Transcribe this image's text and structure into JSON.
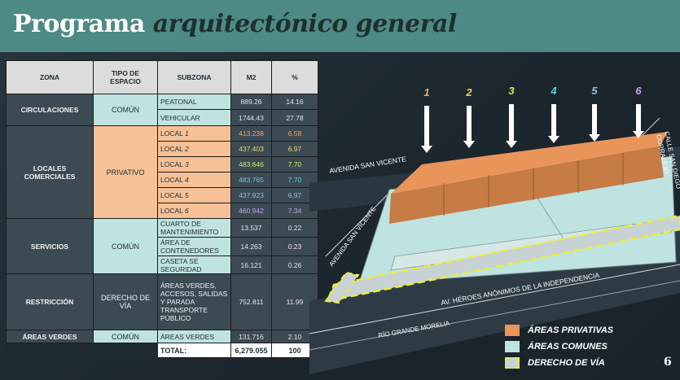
{
  "header": {
    "title_a": "Programa",
    "title_b": "arquitectónico general"
  },
  "table": {
    "headers": [
      "ZONA",
      "TIPO DE ESPACIO",
      "SUBZONA",
      "M2",
      "%"
    ],
    "circ": {
      "zona": "CIRCULACIONES",
      "tipo": "COMÚN",
      "rows": [
        {
          "sub": "PEATONAL",
          "m2": "889.26",
          "pct": "14.16"
        },
        {
          "sub": "VEHICULAR",
          "m2": "1744.43",
          "pct": "27.78"
        }
      ]
    },
    "locales": {
      "zona": "LOCALES COMERCIALES",
      "tipo": "PRIVATIVO",
      "rows": [
        {
          "sub": "LOCAL",
          "n": "1",
          "m2": "413.238",
          "pct": "6.58"
        },
        {
          "sub": "LOCAL",
          "n": "2",
          "m2": "437.403",
          "pct": "6.97"
        },
        {
          "sub": "LOCAL",
          "n": "3",
          "m2": "483.646",
          "pct": "7.70"
        },
        {
          "sub": "LOCAL",
          "n": "4",
          "m2": "483.765",
          "pct": "7.70"
        },
        {
          "sub": "LOCAL",
          "n": "5",
          "m2": "437.923",
          "pct": "6.97"
        },
        {
          "sub": "LOCAL",
          "n": "6",
          "m2": "460.942",
          "pct": "7.34"
        }
      ]
    },
    "serv": {
      "zona": "SERVICIOS",
      "tipo": "COMÚN",
      "rows": [
        {
          "sub": "CUARTO DE MANTENIMIENTO",
          "m2": "13.537",
          "pct": "0.22"
        },
        {
          "sub": "ÁREA DE CONTENEDORES",
          "m2": "14.263",
          "pct": "0.23"
        },
        {
          "sub": "CASETA SE SEGURIDAD",
          "m2": "16.121",
          "pct": "0.26"
        }
      ]
    },
    "rest": {
      "zona": "RESTRICCIÓN",
      "tipo": "DERECHO DE VÍA",
      "sub": "ÁREAS VERDES, ACCESOS, SALIDAS Y PARADA TRANSPORTE PÚBLICO",
      "m2": "752.811",
      "pct": "11.99"
    },
    "verdes": {
      "zona": "ÁREAS VERDES",
      "tipo": "COMÚN",
      "sub": "ÁREAS VERDES",
      "m2": "131.716",
      "pct": "2.10"
    },
    "total": {
      "label": "TOTAL:",
      "m2": "6,279.055",
      "pct": "100"
    }
  },
  "plan": {
    "numbers": [
      "1",
      "2",
      "3",
      "4",
      "5",
      "6"
    ],
    "number_colors": [
      "#f0a766",
      "#e8d76a",
      "#d9ea63",
      "#5ed0e0",
      "#93bdf0",
      "#c8a2f0"
    ],
    "streets": {
      "san_vicente_top": "AVENIDA SAN VICENTE",
      "san_vicente_left": "AVENIDA SAN VICENTE",
      "heroes": "AV. HÉROES ANÓNIMOS DE LA INDEPENDENCIA",
      "rio": "RÍO GRANDE MORELIA",
      "calle_a": "CALLE SAN DIEGO",
      "calle_b": "CORRALEJO"
    }
  },
  "legend": {
    "items": [
      {
        "label": "ÁREAS PRIVATIVAS",
        "color": "#e9955a"
      },
      {
        "label": "ÁREAS COMUNES",
        "color": "#bfe3e0"
      },
      {
        "label": "DERECHO DE VÍA",
        "color": "#c8d1d4"
      }
    ]
  },
  "page_number": "6"
}
